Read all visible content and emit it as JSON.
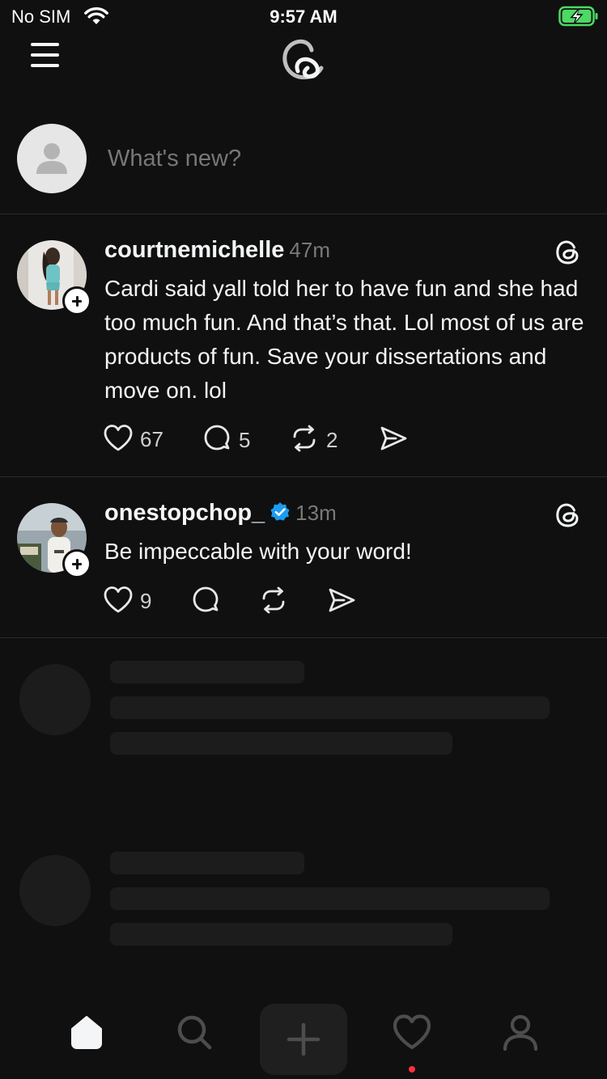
{
  "status_bar": {
    "carrier": "No SIM",
    "time": "9:57 AM",
    "battery_color": "#4cd964",
    "icons": [
      "wifi-icon",
      "battery-charging-icon"
    ]
  },
  "header": {
    "icons": [
      "menu-icon",
      "threads-logo"
    ]
  },
  "composer": {
    "placeholder": "What's new?",
    "avatar_icon": "default-avatar-icon"
  },
  "posts": [
    {
      "username": "courtnemichelle",
      "time": "47m",
      "verified": false,
      "text": "Cardi said yall told her to have fun and she had too much fun. And that’s that. Lol most of us are products of fun. Save your dissertations and move on. lol",
      "likes": "67",
      "replies": "5",
      "reposts": "2"
    },
    {
      "username": "onestopchop_",
      "time": "13m",
      "verified": true,
      "verified_color": "#1d9bf0",
      "text": "Be impeccable with your word!",
      "likes": "9",
      "replies": "",
      "reposts": ""
    }
  ],
  "bottom_nav": {
    "items": [
      "home-icon",
      "search-icon",
      "compose-icon",
      "activity-icon",
      "profile-icon"
    ],
    "active": "home-icon",
    "notification_dot_color": "#ff3040"
  }
}
